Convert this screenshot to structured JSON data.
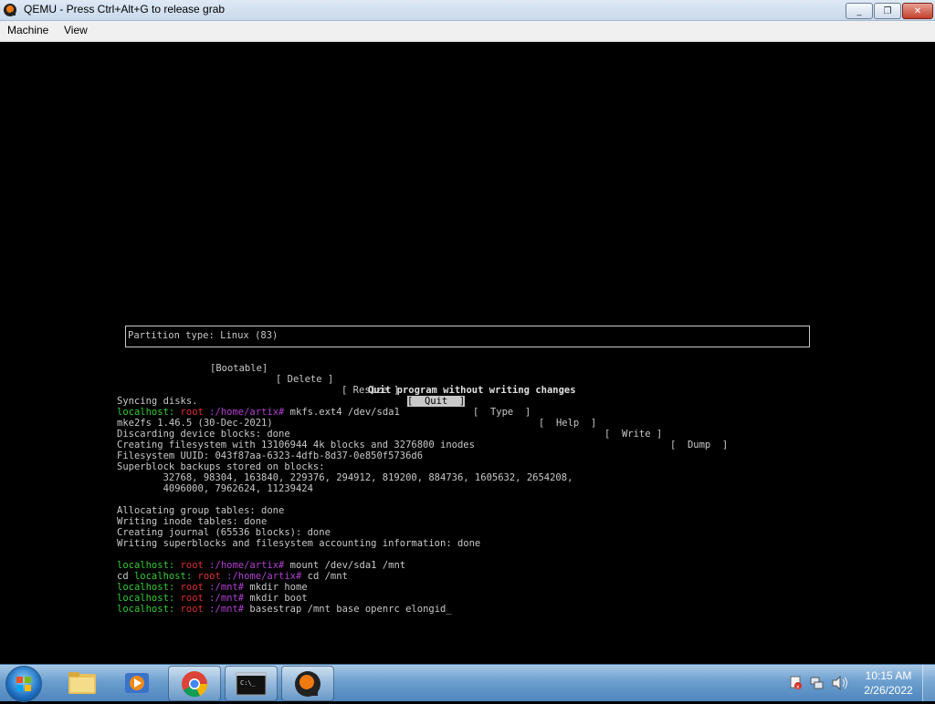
{
  "window": {
    "title": "QEMU - Press Ctrl+Alt+G to release grab",
    "minimize": "_",
    "maximize": "❐",
    "close": "✕"
  },
  "menu": [
    "Machine",
    "View"
  ],
  "cfdisk": {
    "partition_type": "Partition type: Linux (83)",
    "items": [
      "[Bootable]",
      "[ Delete ]",
      "[ Resize ]",
      "[  Quit  ]",
      "[  Type  ]",
      "[  Help  ]",
      "[  Write ]",
      "[  Dump  ]"
    ],
    "selected_index": 3,
    "hint": "Quit program without writing changes"
  },
  "terminal": {
    "host": "localhost:",
    "user": "root",
    "lines": [
      {
        "kind": "text",
        "text": "Syncing disks."
      },
      {
        "kind": "prompt",
        "path": ":/home/artix#",
        "cmd": " mkfs.ext4 /dev/sda1"
      },
      {
        "kind": "text",
        "text": "mke2fs 1.46.5 (30-Dec-2021)"
      },
      {
        "kind": "text",
        "text": "Discarding device blocks: done"
      },
      {
        "kind": "text",
        "text": "Creating filesystem with 13106944 4k blocks and 3276800 inodes"
      },
      {
        "kind": "text",
        "text": "Filesystem UUID: 043f87aa-6323-4dfb-8d37-0e850f5736d6"
      },
      {
        "kind": "text",
        "text": "Superblock backups stored on blocks:"
      },
      {
        "kind": "text",
        "text": "        32768, 98304, 163840, 229376, 294912, 819200, 884736, 1605632, 2654208,"
      },
      {
        "kind": "text",
        "text": "        4096000, 7962624, 11239424"
      },
      {
        "kind": "text",
        "text": ""
      },
      {
        "kind": "text",
        "text": "Allocating group tables: done"
      },
      {
        "kind": "text",
        "text": "Writing inode tables: done"
      },
      {
        "kind": "text",
        "text": "Creating journal (65536 blocks): done"
      },
      {
        "kind": "text",
        "text": "Writing superblocks and filesystem accounting information: done"
      },
      {
        "kind": "text",
        "text": ""
      },
      {
        "kind": "prompt",
        "path": ":/home/artix#",
        "cmd": " mount /dev/sda1 /mnt"
      },
      {
        "kind": "prompt",
        "prefix": "cd ",
        "path": ":/home/artix#",
        "cmd": " cd /mnt"
      },
      {
        "kind": "prompt",
        "path": ":/mnt#",
        "cmd": " mkdir home"
      },
      {
        "kind": "prompt",
        "path": ":/mnt#",
        "cmd": " mkdir boot"
      },
      {
        "kind": "prompt",
        "path": ":/mnt#",
        "cmd": " basestrap /mnt base openrc elongid",
        "cursor": "_"
      }
    ]
  },
  "taskbar": {
    "apps": [
      "windows-explorer",
      "media-player",
      "chrome",
      "command-prompt",
      "qemu"
    ],
    "cmd_label": "C:\\_",
    "time": "10:15 AM",
    "date": "2/26/2022"
  }
}
